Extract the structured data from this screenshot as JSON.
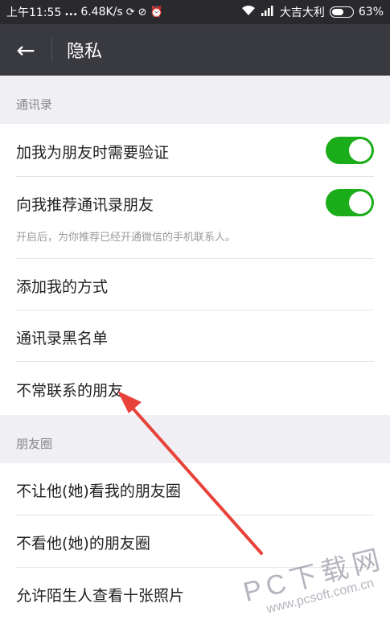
{
  "status_bar": {
    "time": "上午11:55",
    "dots": "...",
    "net_speed": "6.48K/s",
    "carrier": "大吉大利",
    "battery": "63%",
    "battery_fraction": 0.63
  },
  "header": {
    "back_icon": "back-arrow-icon",
    "back_glyph": "←",
    "title": "隐私"
  },
  "sections": {
    "contacts": {
      "header": "通讯录",
      "items": [
        {
          "label": "加我为朋友时需要验证",
          "toggle": true
        },
        {
          "label": "向我推荐通讯录朋友",
          "toggle": true,
          "sub": "开启后，为你推荐已经开通微信的手机联系人。"
        },
        {
          "label": "添加我的方式"
        },
        {
          "label": "通讯录黑名单"
        },
        {
          "label": "不常联系的朋友"
        }
      ]
    },
    "moments": {
      "header": "朋友圈",
      "items": [
        {
          "label": "不让他(她)看我的朋友圈"
        },
        {
          "label": "不看他(她)的朋友圈"
        },
        {
          "label": "允许陌生人查看十张照片"
        }
      ]
    }
  },
  "watermark": {
    "brand": "PC下载网",
    "url": "www.pcsoft.com.cn"
  },
  "colors": {
    "toggle_on": "#1aad19",
    "app_bar": "#393a3f",
    "arrow": "#e8423a"
  }
}
